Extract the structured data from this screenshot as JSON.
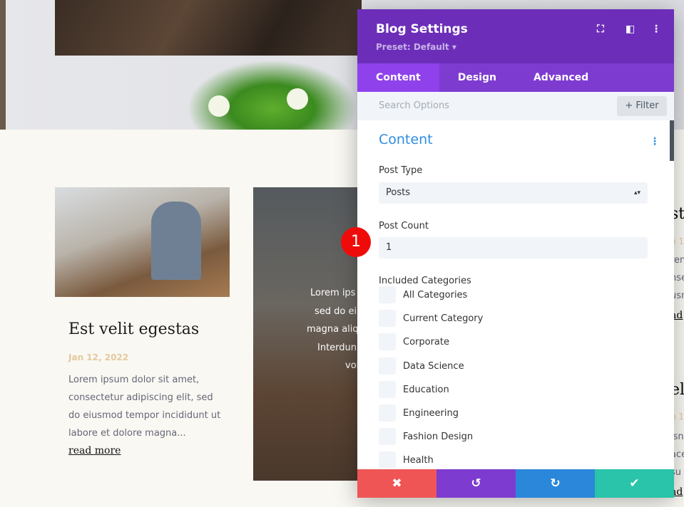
{
  "blog_left": {
    "title": "Est velit egestas",
    "date": "Jan 12, 2022",
    "excerpt": "Lorem ipsum dolor sit amet, consectetur adipiscing elit, sed do eiusmod tempor incididunt ut labore et dolore magna...",
    "read_more": "read more"
  },
  "blog_center": {
    "lines": [
      "Lorem ips",
      "sed do ei",
      "magna aliq",
      "Interdun",
      "vol"
    ]
  },
  "blog_right": {
    "top": [
      "st",
      "n 1",
      "ren",
      "nse",
      "usn",
      "ad"
    ],
    "bottom": [
      "el",
      "n 1",
      "isn",
      "ace",
      "su",
      "ad"
    ]
  },
  "panel": {
    "title": "Blog Settings",
    "preset": "Preset: Default ▾",
    "tabs": [
      "Content",
      "Design",
      "Advanced"
    ],
    "search_placeholder": "Search Options",
    "filter": "+ Filter",
    "section": "Content",
    "post_type_label": "Post Type",
    "post_type_value": "Posts",
    "post_count_label": "Post Count",
    "post_count_value": "1",
    "categories_label": "Included Categories",
    "categories": [
      "All Categories",
      "Current Category",
      "Corporate",
      "Data Science",
      "Education",
      "Engineering",
      "Fashion Design",
      "Health"
    ],
    "footer": {
      "cancel": "✖",
      "undo": "↺",
      "redo": "↻",
      "save": "✔"
    }
  },
  "badge": "1",
  "colors": {
    "header": "#6c2eb9",
    "tabs": "#7e3bd0",
    "active_tab": "#8f42ec",
    "cancel": "#ef5555",
    "undo": "#7e3bd0",
    "redo": "#2b87da",
    "save": "#29c4a9",
    "badge": "#f00b0b"
  }
}
